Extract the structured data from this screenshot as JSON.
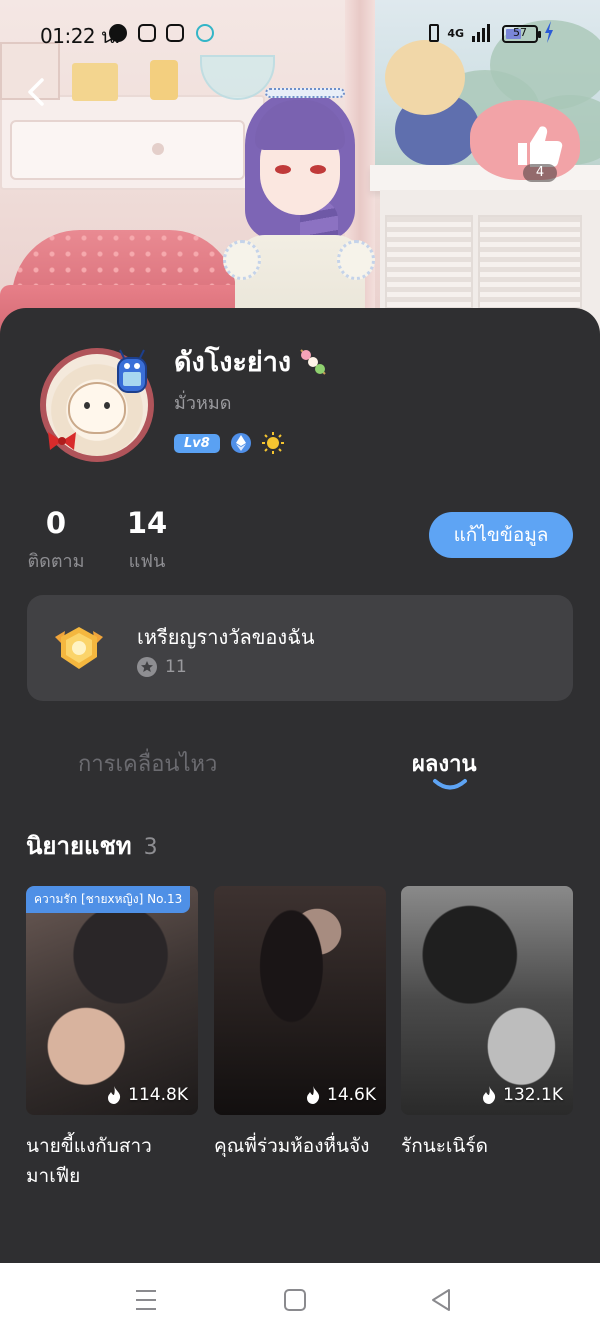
{
  "status_bar": {
    "time": "01:22 น.",
    "network": "4G",
    "battery_level": "57",
    "icons": [
      "pinterest-icon",
      "instagram-icon",
      "instagram-icon",
      "tiktok-icon"
    ]
  },
  "header": {
    "back_icon": "chevron-left-icon",
    "like_icon": "thumbs-up-icon",
    "like_count": "4"
  },
  "profile": {
    "name": "ดังโงะย่าง",
    "name_emoji": "dango-icon",
    "subtitle": "มั่วหมด",
    "level": "Lv8",
    "badge_icons": [
      "ethereum-badge-icon",
      "sun-badge-icon"
    ]
  },
  "stats": [
    {
      "value": "0",
      "label": "ติดตาม"
    },
    {
      "value": "14",
      "label": "แฟน"
    }
  ],
  "edit_button": "แก้ไขข้อมูล",
  "medals": {
    "title": "เหรียญรางวัลของฉัน",
    "count": "11"
  },
  "tabs": [
    {
      "label": "การเคลื่อนไหว",
      "active": false
    },
    {
      "label": "ผลงาน",
      "active": true
    }
  ],
  "section": {
    "title": "นิยายแชท",
    "count": "3"
  },
  "stories": [
    {
      "tag": "ความรัก [ชายxหญิง] No.13",
      "views": "114.8K",
      "title": "นายขี้แงกับสาวมาเฟีย"
    },
    {
      "tag": "",
      "views": "14.6K",
      "title": "คุณพี่ร่วมห้องหื่นจัง"
    },
    {
      "tag": "",
      "views": "132.1K",
      "title": "รักนะเนิร์ด"
    }
  ],
  "navbar": {
    "icons": [
      "menu-icon",
      "home-square-icon",
      "back-triangle-icon"
    ]
  },
  "colors": {
    "panel_bg": "#2f2f31",
    "card_bg": "#414144",
    "accent_blue": "#5ea4f4",
    "avatar_ring": "#b0545a"
  }
}
